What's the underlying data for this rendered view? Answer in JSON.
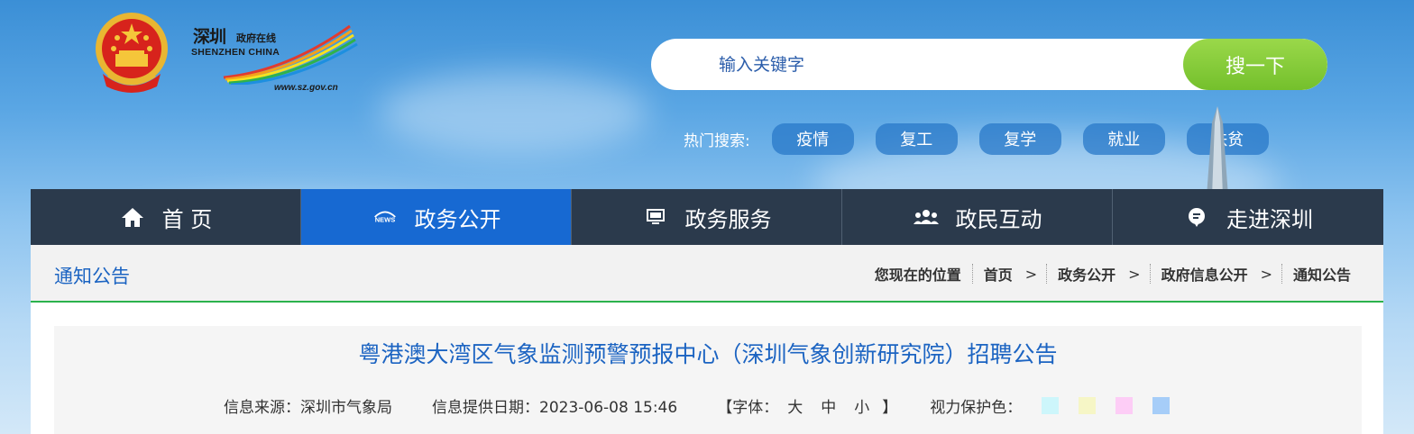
{
  "header": {
    "logo_cn": "深圳",
    "logo_tagline": "政府在线",
    "logo_en": "SHENZHEN  CHINA",
    "logo_url": "www.sz.gov.cn"
  },
  "search": {
    "placeholder": "输入关键字",
    "button_label": "搜一下"
  },
  "hot_search": {
    "label": "热门搜索:",
    "tags": [
      "疫情",
      "复工",
      "复学",
      "就业",
      "扶贫"
    ]
  },
  "nav": {
    "items": [
      {
        "label": "首 页",
        "icon": "home-icon"
      },
      {
        "label": "政务公开",
        "icon": "news-icon"
      },
      {
        "label": "政务服务",
        "icon": "monitor-icon"
      },
      {
        "label": "政民互动",
        "icon": "people-icon"
      },
      {
        "label": "走进深圳",
        "icon": "chat-bubble-icon"
      }
    ],
    "active_index": 1
  },
  "section": {
    "title": "通知公告"
  },
  "breadcrumb": {
    "prefix": "您现在的位置",
    "items": [
      "首页",
      "政务公开",
      "政府信息公开",
      "通知公告"
    ]
  },
  "article": {
    "title": "粤港澳大湾区气象监测预警预报中心（深圳气象创新研究院）招聘公告",
    "source_label": "信息来源：深圳市气象局",
    "date_label": "信息提供日期：2023-06-08 15:46",
    "font_open": "【字体：",
    "font_large": "大",
    "font_medium": "中",
    "font_small": "小",
    "font_close": "】",
    "eye_care_label": "视力保护色："
  },
  "colors": {
    "accent": "#1769d2",
    "nav_bg": "#2b3a4c",
    "search_btn": "#7cc433",
    "divider": "#2bb24c",
    "swatches": [
      "#cdf6fb",
      "#f6f6c6",
      "#fdcdf6",
      "#a6cdf8"
    ]
  }
}
